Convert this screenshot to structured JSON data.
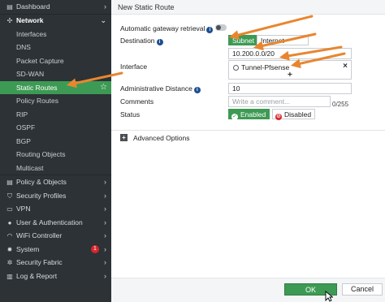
{
  "sidebar": {
    "items": [
      {
        "label": "Dashboard",
        "icon": "dashboard-icon",
        "glyph": "▤",
        "chevron": "›"
      },
      {
        "label": "Network",
        "icon": "network-icon",
        "glyph": "✣",
        "chevron": "⌄"
      },
      {
        "label": "Interfaces"
      },
      {
        "label": "DNS"
      },
      {
        "label": "Packet Capture"
      },
      {
        "label": "SD-WAN"
      },
      {
        "label": "Static Routes",
        "star": "☆"
      },
      {
        "label": "Policy Routes"
      },
      {
        "label": "RIP"
      },
      {
        "label": "OSPF"
      },
      {
        "label": "BGP"
      },
      {
        "label": "Routing Objects"
      },
      {
        "label": "Multicast"
      },
      {
        "label": "Policy & Objects",
        "icon": "policy-icon",
        "glyph": "▤",
        "chevron": "›"
      },
      {
        "label": "Security Profiles",
        "icon": "shield-icon",
        "glyph": "⛉",
        "chevron": "›"
      },
      {
        "label": "VPN",
        "icon": "vpn-icon",
        "glyph": "▭",
        "chevron": "›"
      },
      {
        "label": "User & Authentication",
        "icon": "user-icon",
        "glyph": "●",
        "chevron": "›"
      },
      {
        "label": "WiFi Controller",
        "icon": "wifi-icon",
        "glyph": "◠",
        "chevron": "›"
      },
      {
        "label": "System",
        "icon": "gear-icon",
        "glyph": "✹",
        "chevron": "›",
        "badge": "1"
      },
      {
        "label": "Security Fabric",
        "icon": "fabric-icon",
        "glyph": "✲",
        "chevron": "›"
      },
      {
        "label": "Log & Report",
        "icon": "report-icon",
        "glyph": "▥",
        "chevron": "›"
      }
    ]
  },
  "main": {
    "title": "New Static Route",
    "labels": {
      "auto_gateway": "Automatic gateway retrieval",
      "destination": "Destination",
      "interface": "Interface",
      "admin_distance": "Administrative Distance",
      "comments": "Comments",
      "status": "Status"
    },
    "info_glyph": "i",
    "destination_type": {
      "subnet": "Subnet",
      "internet_service": "Internet Service"
    },
    "destination_value": "10.200.0.0/20",
    "interface": {
      "value": "Tunnel-Pfsense",
      "remove": "×",
      "add": "+"
    },
    "admin_distance_value": "10",
    "comments": {
      "placeholder": "Write a comment...",
      "counter": "0/255"
    },
    "status": {
      "enabled": "Enabled",
      "enabled_glyph": "✓",
      "disabled": "Disabled",
      "disabled_glyph": "⊘"
    },
    "advanced": {
      "label": "Advanced Options",
      "toggle_glyph": "+"
    }
  },
  "footer": {
    "ok": "OK",
    "cancel": "Cancel"
  },
  "colors": {
    "accent": "#3d9a54",
    "sidebar": "#2c3236",
    "annotation_arrow": "#e8862f",
    "badge": "#d8262b"
  }
}
